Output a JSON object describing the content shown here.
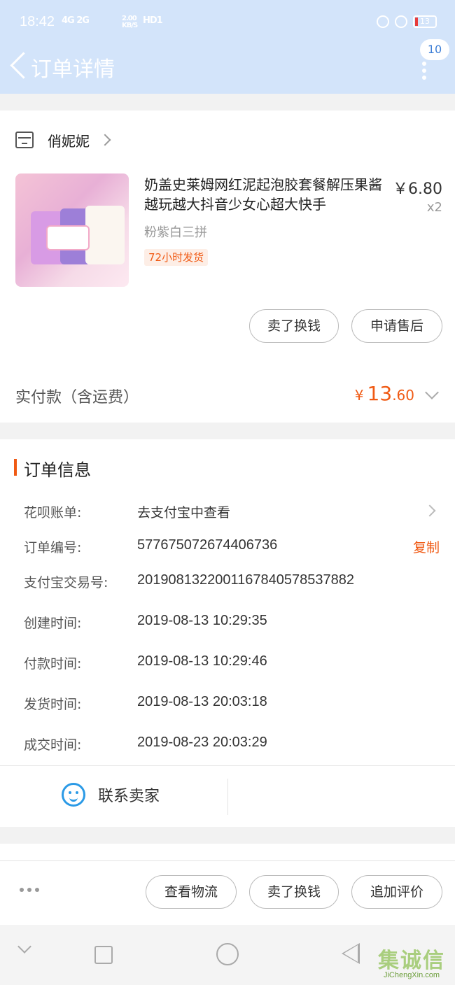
{
  "status_bar": {
    "time": "18:42",
    "signal_text": "4G 2G",
    "speed": "2.00 KB/S",
    "hd": "HD1",
    "battery": "13"
  },
  "nav": {
    "title": "订单详情",
    "message_badge": "10"
  },
  "shop": {
    "name": "俏妮妮"
  },
  "product": {
    "title": "奶盖史莱姆网红泥起泡胶套餐解压果酱越玩越大抖音少女心超大快手",
    "price": "￥6.80",
    "quantity": "x2",
    "sku": "粉紫白三拼",
    "tag": "72小时发货",
    "tag_color": "#f05a14"
  },
  "item_actions": {
    "sell": "卖了换钱",
    "after_sale": "申请售后"
  },
  "payment": {
    "label": "实付款（含运费）",
    "symbol": "¥",
    "integer": "13",
    "decimal": ".60",
    "accent_color": "#f05a14"
  },
  "order_info": {
    "title": "订单信息",
    "rows": [
      {
        "key": "花呗账单:",
        "value": "去支付宝中查看"
      },
      {
        "key": "订单编号:",
        "value": "577675072674406736",
        "action": "复制"
      },
      {
        "key": "支付宝交易号:",
        "value": "2019081322001167840578537882"
      },
      {
        "key": "创建时间:",
        "value": "2019-08-13 10:29:35"
      },
      {
        "key": "付款时间:",
        "value": "2019-08-13 10:29:46"
      },
      {
        "key": "发货时间:",
        "value": "2019-08-13 20:03:18"
      },
      {
        "key": "成交时间:",
        "value": "2019-08-23 20:03:29"
      }
    ]
  },
  "contact": {
    "label": "联系卖家"
  },
  "bottom_actions": {
    "logistics": "查看物流",
    "sell": "卖了换钱",
    "review": "追加评价"
  },
  "watermark": {
    "cn": "集诚信",
    "en": "JiChengXin.com"
  },
  "colors": {
    "header_bg": "#d3e4fa",
    "accent": "#f05a14",
    "contact_blue": "#2b9ae6"
  }
}
